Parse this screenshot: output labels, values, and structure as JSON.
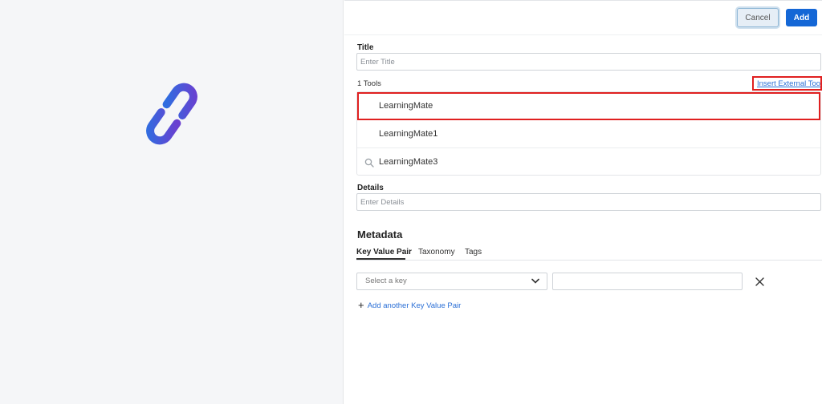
{
  "header": {
    "cancel_label": "Cancel",
    "add_label": "Add"
  },
  "title_field": {
    "label": "Title",
    "placeholder": "Enter Title"
  },
  "tools": {
    "count_label": "1 Tools",
    "insert_link": "Insert External Tool",
    "items": [
      "LearningMate",
      "LearningMate1",
      "LearningMate3"
    ],
    "selected_index": 0
  },
  "details_field": {
    "label": "Details",
    "placeholder": "Enter Details"
  },
  "metadata": {
    "title": "Metadata",
    "tabs": [
      "Key Value Pair",
      "Taxonomy",
      "Tags"
    ],
    "active_tab": "Key Value Pair",
    "key_select_placeholder": "Select a key",
    "add_pair_label": "Add another Key Value Pair"
  },
  "icons": {
    "logo": "link-chain-icon",
    "search": "search-icon",
    "dropdown": "chevron-down-icon",
    "remove": "close-icon",
    "add": "plus-icon"
  },
  "colors": {
    "accent": "#1467d6",
    "highlight": "#e02020",
    "logo_gradient_start": "#2f6de0",
    "logo_gradient_end": "#6a3fd0"
  }
}
